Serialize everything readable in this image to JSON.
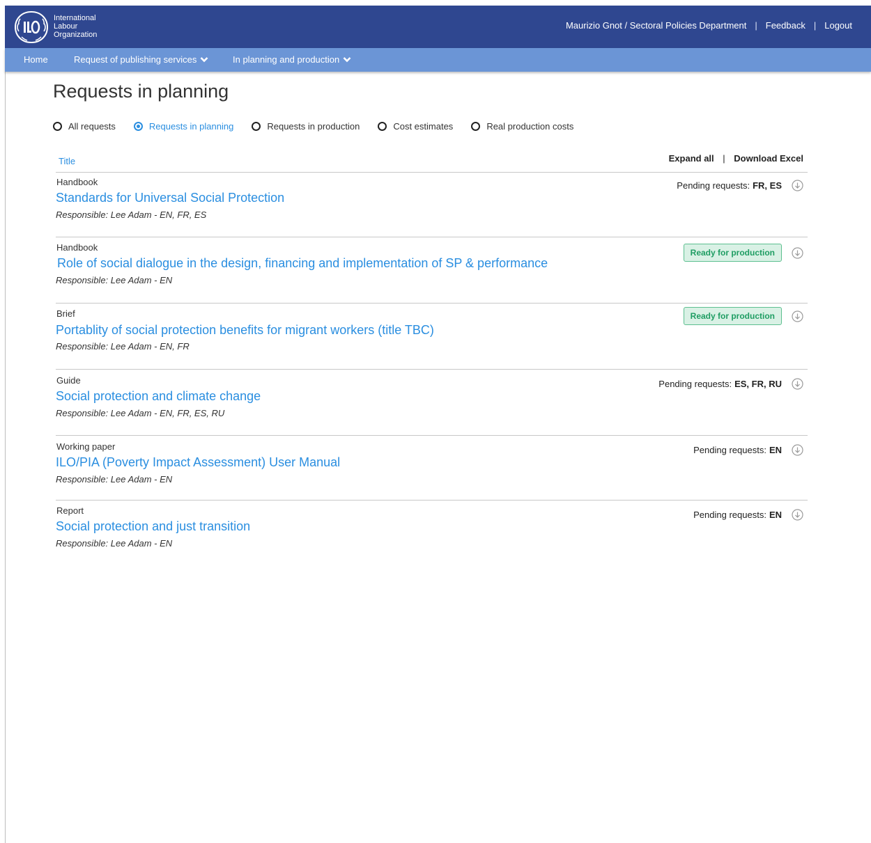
{
  "header": {
    "org_name": [
      "International",
      "Labour",
      "Organization"
    ],
    "user": "Maurizio Gnot / Sectoral Policies Department",
    "feedback": "Feedback",
    "logout": "Logout",
    "separator": "|",
    "brand_color": "#2f4790"
  },
  "nav": {
    "home": "Home",
    "publishing": "Request of publishing services",
    "planning": "In planning and production",
    "color": "#6b95d6"
  },
  "page": {
    "title": "Requests in planning"
  },
  "filters": {
    "options": [
      "All requests",
      "Requests in planning",
      "Requests in production",
      "Cost estimates",
      "Real production costs"
    ],
    "selected": "Requests in planning"
  },
  "table": {
    "column_title": "Title",
    "expand_all": "Expand all",
    "separator": "|",
    "download_excel": "Download Excel",
    "pending_label": "Pending requests:",
    "ready_label": "Ready for production",
    "rows": [
      {
        "type": "Handbook",
        "title": "Standards for Universal Social Protection",
        "responsible": "Responsible: Lee Adam - EN, FR, ES",
        "status": "pending",
        "pending_langs": "FR, ES"
      },
      {
        "type": "Handbook",
        "title": "Role of social dialogue in the design, financing and implementation of SP & performance",
        "responsible": "Responsible: Lee Adam - EN",
        "status": "ready"
      },
      {
        "type": "Brief",
        "title": "Portablity of social protection benefits for migrant workers (title TBC)",
        "responsible": "Responsible: Lee Adam - EN, FR",
        "status": "ready"
      },
      {
        "type": "Guide",
        "title": "Social protection and climate change",
        "responsible": "Responsible: Lee Adam - EN, FR, ES, RU",
        "status": "pending",
        "pending_langs": "ES, FR, RU"
      },
      {
        "type": "Working paper",
        "title": "ILO/PIA (Poverty Impact Assessment) User Manual",
        "responsible": "Responsible: Lee Adam - EN",
        "status": "pending",
        "pending_langs": "EN"
      },
      {
        "type": "Report",
        "title": "Social protection and just transition",
        "responsible": "Responsible: Lee Adam - EN",
        "status": "pending",
        "pending_langs": "EN"
      }
    ]
  },
  "colors": {
    "link": "#2a8ee0",
    "badge_bg": "#d9f1e5",
    "badge_border": "#5cbf8f",
    "badge_text": "#1f9d63"
  },
  "icons": {
    "logo": "ilo-logo",
    "nav_dropdown": "chevron-down-icon",
    "download": "download-circle-icon"
  }
}
